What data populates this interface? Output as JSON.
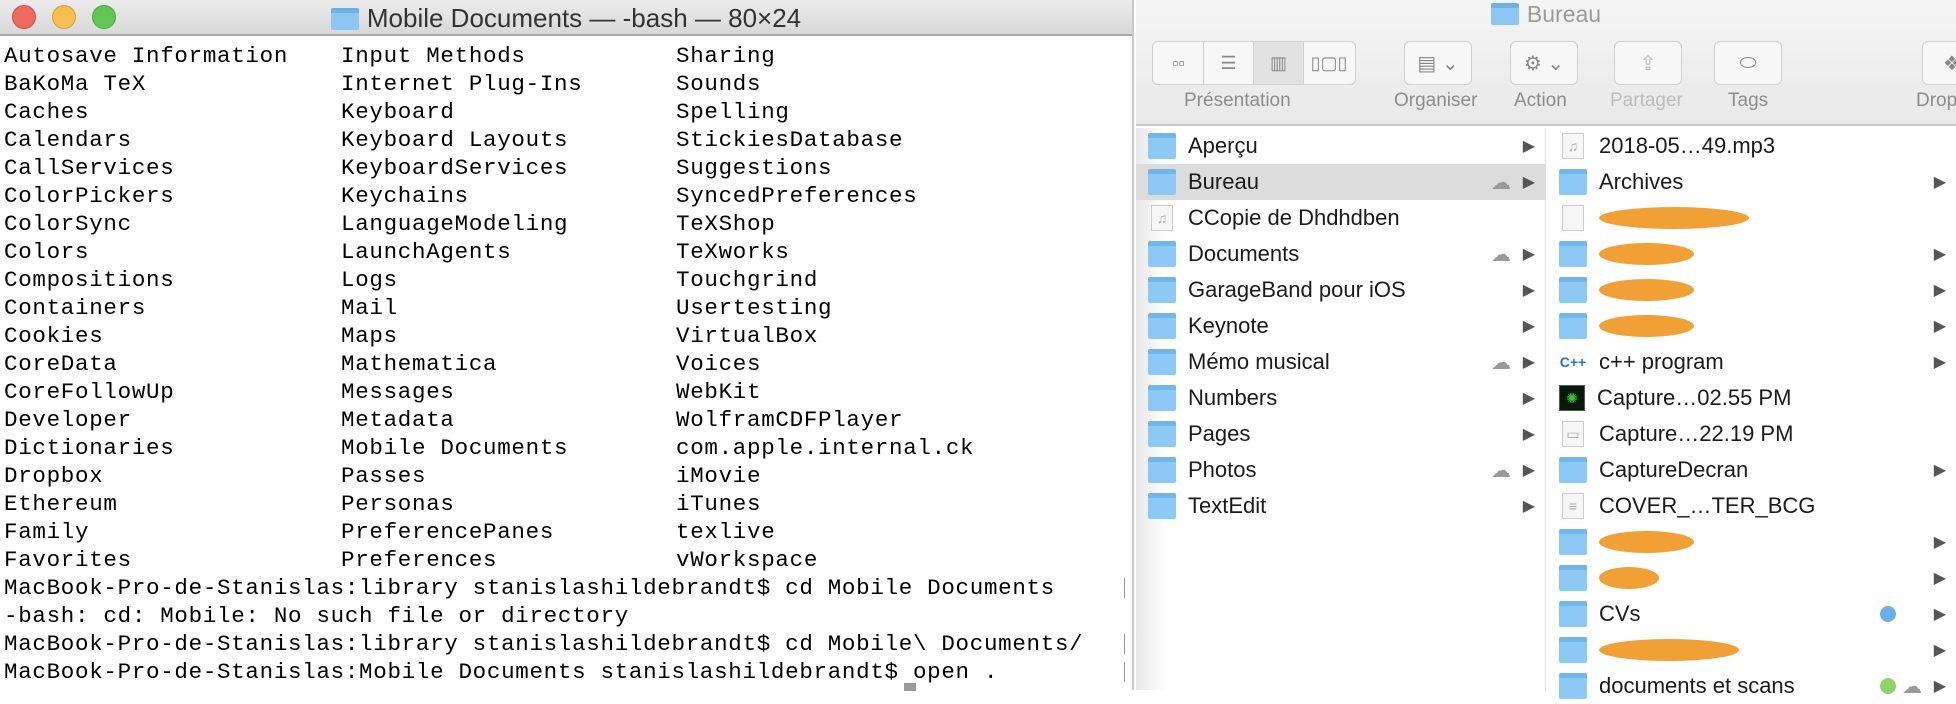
{
  "terminal": {
    "title": "Mobile Documents — -bash — 80×24",
    "columns": [
      [
        "Autosave Information",
        "BaKoMa TeX",
        "Caches",
        "Calendars",
        "CallServices",
        "ColorPickers",
        "ColorSync",
        "Colors",
        "Compositions",
        "Containers",
        "Cookies",
        "CoreData",
        "CoreFollowUp",
        "Developer",
        "Dictionaries",
        "Dropbox",
        "Ethereum",
        "Family",
        "Favorites"
      ],
      [
        "Input Methods",
        "Internet Plug-Ins",
        "Keyboard",
        "Keyboard Layouts",
        "KeyboardServices",
        "Keychains",
        "LanguageModeling",
        "LaunchAgents",
        "Logs",
        "Mail",
        "Maps",
        "Mathematica",
        "Messages",
        "Metadata",
        "Mobile Documents",
        "Passes",
        "Personas",
        "PreferencePanes",
        "Preferences"
      ],
      [
        "Sharing",
        "Sounds",
        "Spelling",
        "StickiesDatabase",
        "Suggestions",
        "SyncedPreferences",
        "TeXShop",
        "TeXworks",
        "Touchgrind",
        "Usertesting",
        "VirtualBox",
        "Voices",
        "WebKit",
        "WolframCDFPlayer",
        "com.apple.internal.ck",
        "iMovie",
        "iTunes",
        "texlive",
        "vWorkspace"
      ]
    ],
    "lines": [
      "MacBook-Pro-de-Stanislas:library stanislashildebrandt$ cd Mobile Documents",
      "-bash: cd: Mobile: No such file or directory",
      "MacBook-Pro-de-Stanislas:library stanislashildebrandt$ cd Mobile\\ Documents/",
      "MacBook-Pro-de-Stanislas:Mobile Documents stanislashildebrandt$ open ."
    ]
  },
  "finder": {
    "title": "Bureau",
    "toolbar": {
      "presentation": "Présentation",
      "organiser": "Organiser",
      "action": "Action",
      "partager": "Partager",
      "tags": "Tags",
      "dropbox": "Drop"
    },
    "col1": [
      {
        "name": "Aperçu",
        "cloud": false
      },
      {
        "name": "Bureau",
        "cloud": true,
        "selected": true
      },
      {
        "name": "CCopie de Dhdhdben",
        "cloud": false,
        "file": true
      },
      {
        "name": "Documents",
        "cloud": true
      },
      {
        "name": "GarageBand pour iOS",
        "cloud": false
      },
      {
        "name": "Keynote",
        "cloud": false
      },
      {
        "name": "Mémo musical",
        "cloud": true
      },
      {
        "name": "Numbers",
        "cloud": false
      },
      {
        "name": "Pages",
        "cloud": false
      },
      {
        "name": "Photos",
        "cloud": true
      },
      {
        "name": "TextEdit",
        "cloud": false
      }
    ],
    "col2": [
      {
        "name": "2018-05…49.mp3",
        "kind": "audio"
      },
      {
        "name": "Archives",
        "kind": "folder"
      },
      {
        "name": "",
        "kind": "pdf",
        "redacted": true
      },
      {
        "name": "",
        "kind": "folder",
        "redacted": true
      },
      {
        "name": "",
        "kind": "folder",
        "redacted": true
      },
      {
        "name": "",
        "kind": "folder",
        "redacted": true
      },
      {
        "name": "c++ program",
        "kind": "cpp"
      },
      {
        "name": "Capture…02.55 PM",
        "kind": "image"
      },
      {
        "name": "Capture…22.19 PM",
        "kind": "screenshot"
      },
      {
        "name": "CaptureDecran",
        "kind": "folder"
      },
      {
        "name": "COVER_…TER_BCG",
        "kind": "doc"
      },
      {
        "name": "",
        "kind": "folder",
        "redacted": true
      },
      {
        "name": "",
        "kind": "folder",
        "redacted": true
      },
      {
        "name": "CVs",
        "kind": "folder",
        "tag": "#6aaef0"
      },
      {
        "name": "",
        "kind": "folder",
        "redacted": true
      },
      {
        "name": "documents et scans",
        "kind": "folder",
        "tag": "#8fd36a",
        "cloud": true
      }
    ]
  }
}
